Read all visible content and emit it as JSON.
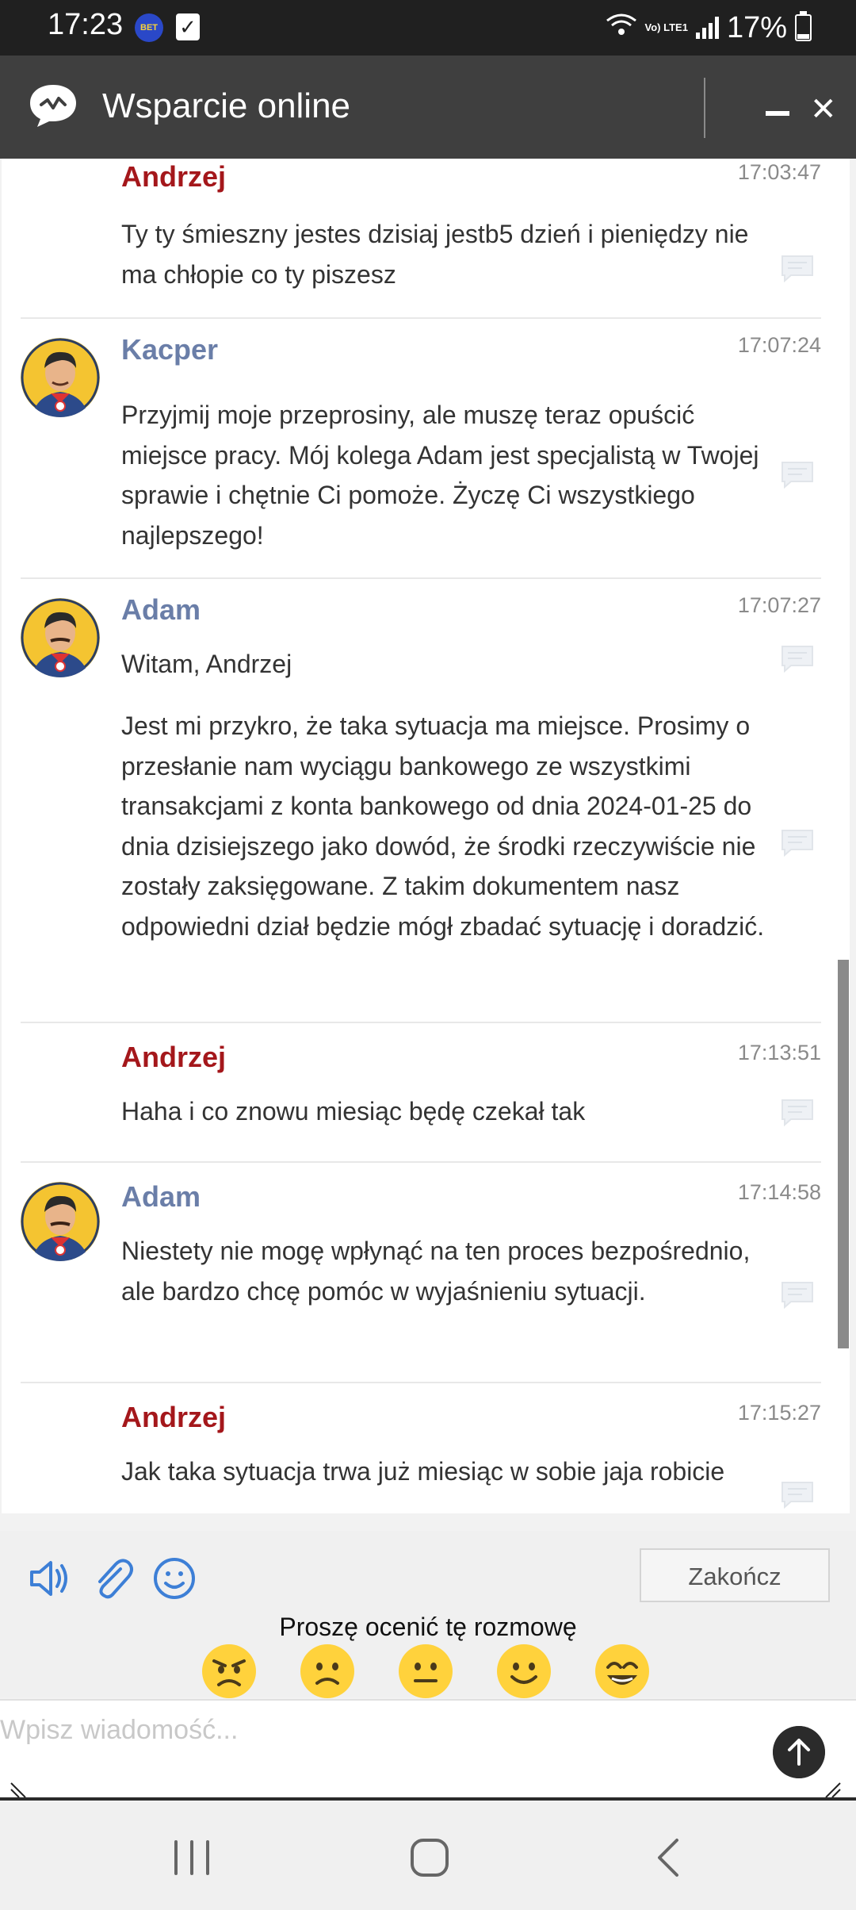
{
  "status_bar": {
    "time": "17:23",
    "network": "Vo) LTE1",
    "battery": "17%"
  },
  "header": {
    "title": "Wsparcie online"
  },
  "messages": [
    {
      "author": "Andrzej",
      "role": "customer",
      "time": "17:03:47",
      "paragraphs": [
        "Ty ty śmieszny jestes dzisiaj jestb5 dzień i pieniędzy nie ma chłopie co ty piszesz"
      ]
    },
    {
      "author": "Kacper",
      "role": "agent",
      "time": "17:07:24",
      "paragraphs": [
        "Przyjmij moje przeprosiny, ale muszę teraz opuścić miejsce pracy. Mój kolega Adam jest specjalistą w Twojej sprawie i chętnie Ci pomoże. Życzę Ci wszystkiego najlepszego!"
      ]
    },
    {
      "author": "Adam",
      "role": "agent",
      "time": "17:07:27",
      "paragraphs": [
        "Witam, Andrzej",
        "Jest mi przykro, że taka sytuacja ma miejsce. Prosimy o przesłanie nam wyciągu bankowego ze wszystkimi transakcjami z konta bankowego od dnia 2024-01-25 do dnia dzisiejszego jako dowód, że środki rzeczywiście nie zostały zaksięgowane. Z takim dokumentem nasz odpowiedni dział będzie mógł zbadać sytuację i doradzić."
      ]
    },
    {
      "author": "Andrzej",
      "role": "customer",
      "time": "17:13:51",
      "paragraphs": [
        "Haha i co znowu miesiąc będę czekał tak"
      ]
    },
    {
      "author": "Adam",
      "role": "agent",
      "time": "17:14:58",
      "paragraphs": [
        "Niestety nie mogę wpłynąć na ten proces bezpośrednio, ale bardzo chcę pomóc w wyjaśnieniu sytuacji."
      ]
    },
    {
      "author": "Andrzej",
      "role": "customer",
      "time": "17:15:27",
      "paragraphs": [
        "Jak taka sytuacja trwa już miesiąc w sobie jaja robicie"
      ]
    }
  ],
  "toolbar": {
    "end_label": "Zakończ",
    "icons": [
      "speaker-icon",
      "paperclip-icon",
      "emoji-icon"
    ]
  },
  "rating": {
    "prompt": "Proszę ocenić tę rozmowę",
    "options": [
      "angry-face-icon",
      "sad-face-icon",
      "neutral-face-icon",
      "happy-face-icon",
      "love-face-icon"
    ]
  },
  "composer": {
    "placeholder": "Wpisz wiadomość...",
    "value": ""
  },
  "colors": {
    "customer_name": "#a4171b",
    "agent_name": "#6a7ea8",
    "header_bg": "#3f3f3f",
    "face_yellow": "#ffd23c"
  }
}
